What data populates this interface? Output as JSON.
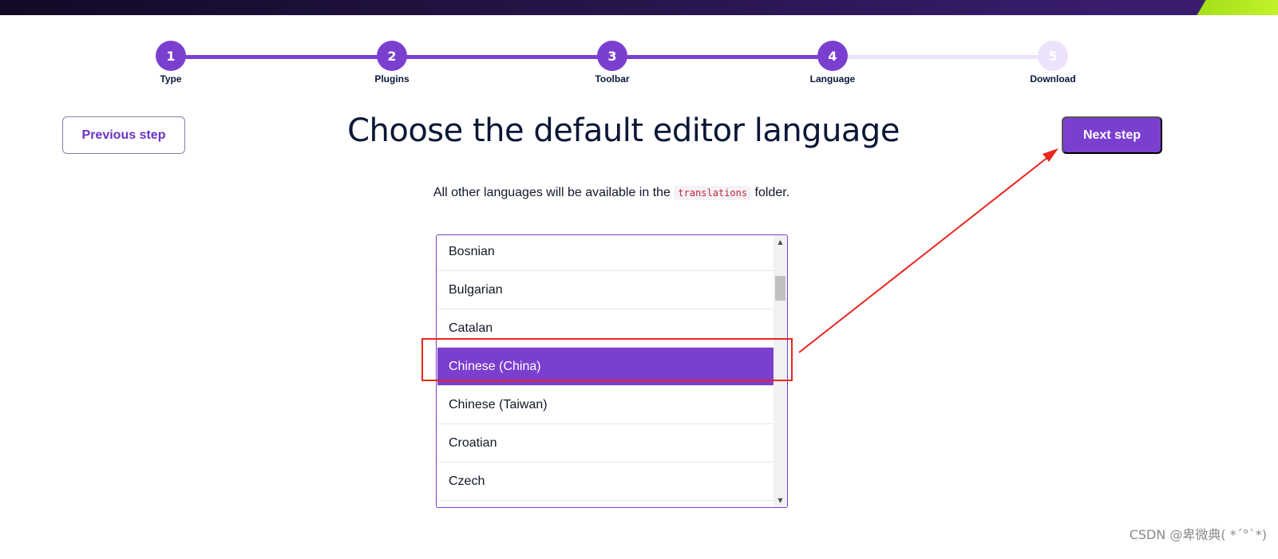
{
  "stepper": {
    "steps": [
      {
        "number": "1",
        "label": "Type",
        "state": "done"
      },
      {
        "number": "2",
        "label": "Plugins",
        "state": "done"
      },
      {
        "number": "3",
        "label": "Toolbar",
        "state": "done"
      },
      {
        "number": "4",
        "label": "Language",
        "state": "current"
      },
      {
        "number": "5",
        "label": "Download",
        "state": "todo"
      }
    ]
  },
  "nav": {
    "previous_label": "Previous step",
    "next_label": "Next step"
  },
  "main": {
    "title": "Choose the default editor language",
    "subtitle_before": "All other languages will be available in the",
    "subtitle_code": "translations",
    "subtitle_after": "folder."
  },
  "language_list": {
    "items": [
      {
        "label": "Bosnian",
        "selected": false
      },
      {
        "label": "Bulgarian",
        "selected": false
      },
      {
        "label": "Catalan",
        "selected": false
      },
      {
        "label": "Chinese (China)",
        "selected": true
      },
      {
        "label": "Chinese (Taiwan)",
        "selected": false
      },
      {
        "label": "Croatian",
        "selected": false
      },
      {
        "label": "Czech",
        "selected": false
      }
    ]
  },
  "watermark": "CSDN @卑微典( *´°`*)",
  "colors": {
    "accent": "#7b3fd0",
    "accent_light": "#ece3fb",
    "annotation": "#e8271f"
  }
}
